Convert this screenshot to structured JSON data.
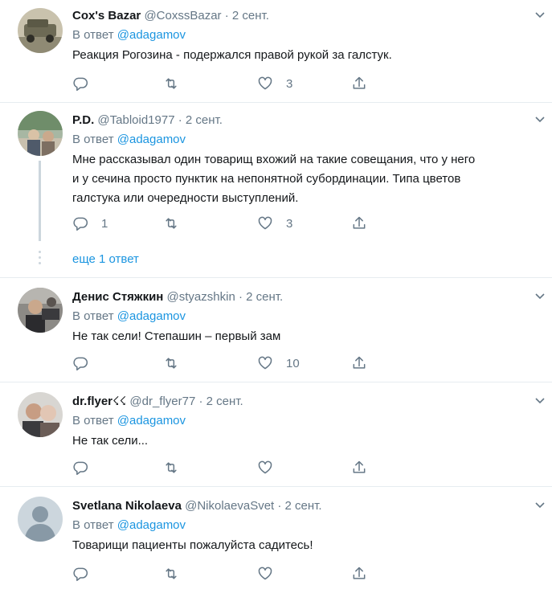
{
  "tweets": [
    {
      "name": "Cox's Bazar",
      "handle": "@CoxssBazar",
      "dot": "·",
      "time": "2 сент.",
      "reply_prefix": "В ответ",
      "reply_to": "@adagamov",
      "text": [
        "Реакция Рогозина - подержался правой рукой за галстук."
      ],
      "reply_count": "",
      "retweet_count": "",
      "like_count": "3"
    },
    {
      "name": "P.D.",
      "handle": "@Tabloid1977",
      "dot": "·",
      "time": "2 сент.",
      "reply_prefix": "В ответ",
      "reply_to": "@adagamov",
      "text": [
        "Мне рассказывал один товарищ вхожий на такие совещания, что у него",
        "и у сечина просто пунктик на непонятной субординации. Типа цветов",
        "галстука или очередности выступлений."
      ],
      "reply_count": "1",
      "retweet_count": "",
      "like_count": "3",
      "more_replies": "еще 1 ответ"
    },
    {
      "name": "Денис Стяжкин",
      "handle": "@styazshkin",
      "dot": "·",
      "time": "2 сент.",
      "reply_prefix": "В ответ",
      "reply_to": "@adagamov",
      "text": [
        "Не так сели! Степашин – первый зам"
      ],
      "reply_count": "",
      "retweet_count": "",
      "like_count": "10"
    },
    {
      "name": "dr.flyer",
      "name_badge": "☇☇",
      "handle": "@dr_flyer77",
      "dot": "·",
      "time": "2 сент.",
      "reply_prefix": "В ответ",
      "reply_to": "@adagamov",
      "text": [
        "Не так сели..."
      ],
      "reply_count": "",
      "retweet_count": "",
      "like_count": ""
    },
    {
      "name": "Svetlana Nikolaeva",
      "handle": "@NikolaevaSvet",
      "dot": "·",
      "time": "2 сент.",
      "reply_prefix": "В ответ",
      "reply_to": "@adagamov",
      "text": [
        "Товарищи пациенты пожалуйста садитесь!"
      ],
      "reply_count": "",
      "retweet_count": "",
      "like_count": ""
    }
  ],
  "icons": {
    "reply": "reply-icon",
    "retweet": "retweet-icon",
    "like": "heart-icon",
    "share": "share-icon",
    "menu": "chevron-down-icon"
  },
  "colors": {
    "link": "#1b95e0",
    "muted": "#657786",
    "text": "#14171a",
    "divider": "#e6ecf0",
    "thread": "#ccd6dd"
  }
}
